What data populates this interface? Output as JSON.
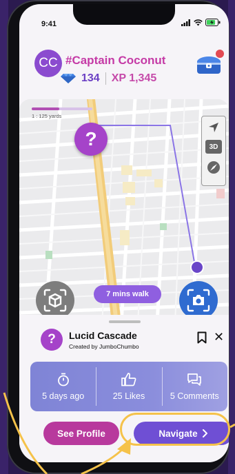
{
  "status_bar": {
    "time": "9:41"
  },
  "profile": {
    "avatar_initials": "CC",
    "username": "#Captain Coconut",
    "gems": "134",
    "xp": "XP 1,345"
  },
  "map": {
    "scale_label": "1 : 125 yards",
    "walk_label": "7 mins walk",
    "controls": {
      "three_d": "3D"
    },
    "marker": "?"
  },
  "quest": {
    "title": "Lucid Cascade",
    "creator": "Created by JumboChumbo",
    "icon": "?",
    "stats": [
      {
        "icon": "stopwatch-icon",
        "label": "5 days ago"
      },
      {
        "icon": "thumbs-up-icon",
        "label": "25 Likes"
      },
      {
        "icon": "comments-icon",
        "label": "5 Comments"
      }
    ]
  },
  "actions": {
    "see_profile": "See Profile",
    "navigate": "Navigate"
  },
  "colors": {
    "accent_pink": "#b8399d",
    "accent_purple": "#6f4fd4",
    "annotation": "#f5c24a"
  }
}
